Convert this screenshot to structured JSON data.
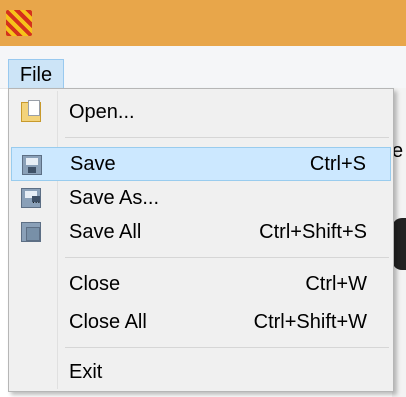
{
  "menubar": {
    "file_label": "File"
  },
  "menu": {
    "items": [
      {
        "label": "Open...",
        "shortcut": "",
        "icon": "open-folder-icon"
      },
      {
        "label": "Save",
        "shortcut": "Ctrl+S",
        "icon": "save-disk-icon",
        "highlighted": true
      },
      {
        "label": "Save As...",
        "shortcut": "",
        "icon": "save-as-icon"
      },
      {
        "label": "Save All",
        "shortcut": "Ctrl+Shift+S",
        "icon": "save-all-icon"
      },
      {
        "label": "Close",
        "shortcut": "Ctrl+W"
      },
      {
        "label": "Close All",
        "shortcut": "Ctrl+Shift+W"
      },
      {
        "label": "Exit",
        "shortcut": ""
      }
    ]
  },
  "background": {
    "peek_letter": "e"
  },
  "colors": {
    "titlebar": "#e8a64a",
    "highlight": "#cce8ff",
    "highlight_border": "#99ccee"
  }
}
